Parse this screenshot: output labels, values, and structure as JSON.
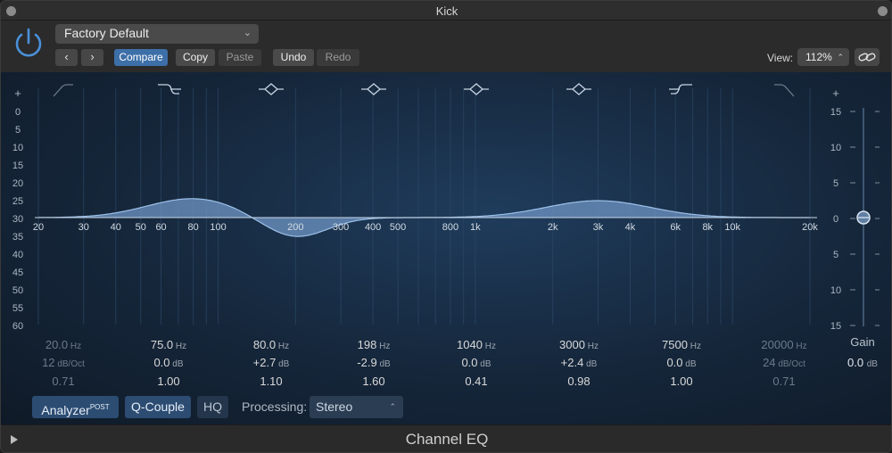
{
  "window": {
    "title": "Kick"
  },
  "header": {
    "preset": "Factory Default",
    "back_icon": "chevron-left-icon",
    "forward_icon": "chevron-right-icon",
    "compare": "Compare",
    "copy": "Copy",
    "paste": "Paste",
    "undo": "Undo",
    "redo": "Redo",
    "view_label": "View:",
    "view_value": "112%",
    "link_icon": "link-icon"
  },
  "graph": {
    "db_labels": [
      "0",
      "5",
      "10",
      "15",
      "20",
      "25",
      "30",
      "35",
      "40",
      "45",
      "50",
      "55",
      "60"
    ],
    "gain_scale": [
      "15",
      "10",
      "5",
      "0",
      "5",
      "10",
      "15"
    ],
    "freq_labels": [
      {
        "label": "20",
        "hz": 20
      },
      {
        "label": "30",
        "hz": 30
      },
      {
        "label": "40",
        "hz": 40
      },
      {
        "label": "50",
        "hz": 50
      },
      {
        "label": "60",
        "hz": 60
      },
      {
        "label": "80",
        "hz": 80
      },
      {
        "label": "100",
        "hz": 100
      },
      {
        "label": "200",
        "hz": 200
      },
      {
        "label": "300",
        "hz": 300
      },
      {
        "label": "400",
        "hz": 400
      },
      {
        "label": "500",
        "hz": 500
      },
      {
        "label": "800",
        "hz": 800
      },
      {
        "label": "1k",
        "hz": 1000
      },
      {
        "label": "2k",
        "hz": 2000
      },
      {
        "label": "3k",
        "hz": 3000
      },
      {
        "label": "4k",
        "hz": 4000
      },
      {
        "label": "6k",
        "hz": 6000
      },
      {
        "label": "8k",
        "hz": 8000
      },
      {
        "label": "10k",
        "hz": 10000
      },
      {
        "label": "20k",
        "hz": 20000
      }
    ]
  },
  "bands": [
    {
      "freq": "20.0",
      "freq_unit": "Hz",
      "gain": "12",
      "gain_unit": "dB/Oct",
      "q": "0.71",
      "type": "lowcut",
      "icon": "low-cut-icon",
      "enabled": false
    },
    {
      "freq": "75.0",
      "freq_unit": "Hz",
      "gain": "0.0",
      "gain_unit": "dB",
      "q": "1.00",
      "type": "lowshelf",
      "icon": "low-shelf-icon",
      "enabled": true
    },
    {
      "freq": "80.0",
      "freq_unit": "Hz",
      "gain": "+2.7",
      "gain_unit": "dB",
      "q": "1.10",
      "type": "peak",
      "icon": "peak-icon",
      "enabled": true
    },
    {
      "freq": "198",
      "freq_unit": "Hz",
      "gain": "-2.9",
      "gain_unit": "dB",
      "q": "1.60",
      "type": "peak",
      "icon": "peak-icon",
      "enabled": true
    },
    {
      "freq": "1040",
      "freq_unit": "Hz",
      "gain": "0.0",
      "gain_unit": "dB",
      "q": "0.41",
      "type": "peak",
      "icon": "peak-icon",
      "enabled": true
    },
    {
      "freq": "3000",
      "freq_unit": "Hz",
      "gain": "+2.4",
      "gain_unit": "dB",
      "q": "0.98",
      "type": "peak",
      "icon": "peak-icon",
      "enabled": true
    },
    {
      "freq": "7500",
      "freq_unit": "Hz",
      "gain": "0.0",
      "gain_unit": "dB",
      "q": "1.00",
      "type": "highshelf",
      "icon": "high-shelf-icon",
      "enabled": true
    },
    {
      "freq": "20000",
      "freq_unit": "Hz",
      "gain": "24",
      "gain_unit": "dB/Oct",
      "q": "0.71",
      "type": "highcut",
      "icon": "high-cut-icon",
      "enabled": false
    }
  ],
  "master_gain": {
    "label": "Gain",
    "value": "0.0",
    "unit": "dB",
    "db": 0
  },
  "bottom": {
    "analyzer": "Analyzer",
    "analyzer_sup": "POST",
    "qcouple": "Q-Couple",
    "hq": "HQ",
    "processing_label": "Processing:",
    "processing_value": "Stereo"
  },
  "footer": {
    "title": "Channel EQ",
    "play_icon": "play-icon"
  },
  "colors": {
    "accent": "#3d6fa8",
    "curve_fill": "#6f95c4",
    "curve_line": "#9cc0e8"
  }
}
